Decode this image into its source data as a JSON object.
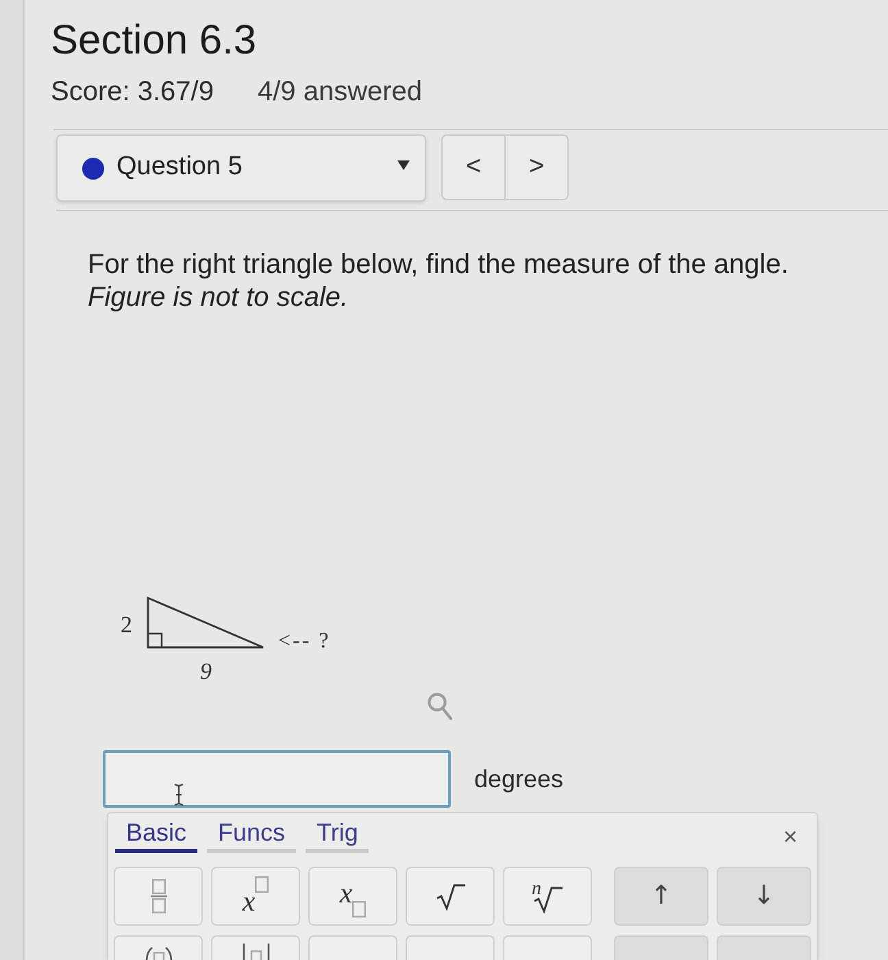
{
  "section": {
    "title": "Section 6.3",
    "score": "Score: 3.67/9",
    "progress": "4/9 answered"
  },
  "question_picker": {
    "label": "Question 5",
    "prev": "<",
    "next": ">"
  },
  "question": {
    "prompt": "For the right triangle below, find the measure of the angle.",
    "note": "Figure is not to scale."
  },
  "figure": {
    "vertical_side": "2",
    "horizontal_side": "9",
    "angle_label": "<-- ?"
  },
  "answer": {
    "unit": "degrees"
  },
  "keypad": {
    "tabs": [
      {
        "label": "Basic",
        "selected": true
      },
      {
        "label": "Funcs",
        "selected": false
      },
      {
        "label": "Trig",
        "selected": false
      }
    ],
    "close": "×",
    "rows": [
      [
        {
          "kind": "fraction"
        },
        {
          "kind": "power",
          "label": "x"
        },
        {
          "kind": "subscript",
          "label": "x"
        },
        {
          "kind": "sqrt"
        },
        {
          "kind": "root",
          "label": "n"
        },
        {
          "kind": "control",
          "label": "↑"
        },
        {
          "kind": "control",
          "label": "↓"
        }
      ],
      [
        {
          "kind": "parens"
        },
        {
          "kind": "abs"
        },
        {
          "kind": "empty"
        },
        {
          "kind": "empty"
        },
        {
          "kind": "empty"
        },
        {
          "kind": "control"
        },
        {
          "kind": "control"
        }
      ]
    ]
  }
}
